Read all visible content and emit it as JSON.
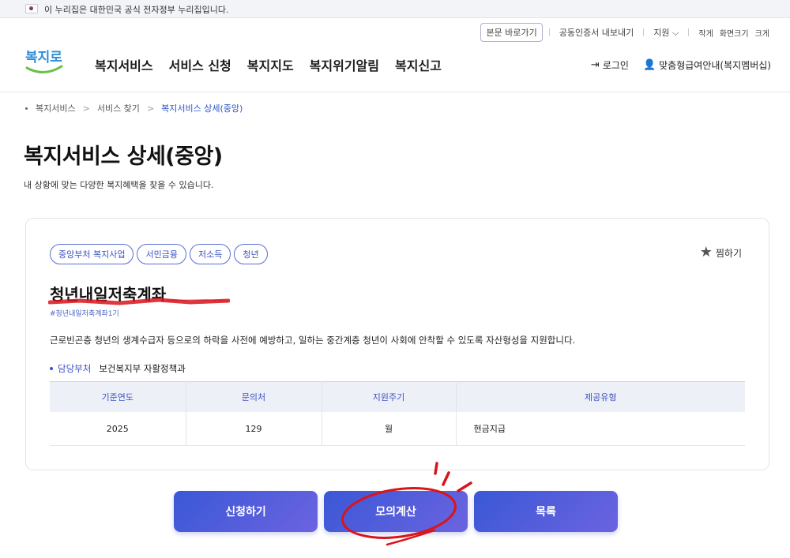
{
  "gov_banner": {
    "text": "이 누리집은 대한민국 공식 전자정부 누리집입니다."
  },
  "utility": {
    "skip_to_content": "본문 바로가기",
    "cert_export": "공동인증서 내보내기",
    "language": "지원",
    "text_small": "작게",
    "text_size": "화면크기",
    "text_large": "크게"
  },
  "logo": {
    "text": "복지로"
  },
  "nav": {
    "items": [
      "복지서비스",
      "서비스 신청",
      "복지지도",
      "복지위기알림",
      "복지신고"
    ]
  },
  "header_right": {
    "login": "로그인",
    "custom_info": "맞춤형급여안내(복지멤버십)"
  },
  "breadcrumb": [
    "복지서비스",
    "서비스 찾기",
    "복지서비스 상세(중앙)"
  ],
  "page": {
    "title": "복지서비스 상세(중앙)",
    "subtitle": "내 상황에 맞는 다양한 복지혜택을 찾을 수 있습니다."
  },
  "service": {
    "tags": [
      "중앙부처 복지사업",
      "서민금융",
      "저소득",
      "청년"
    ],
    "favorite": "찜하기",
    "name": "청년내일저축계좌",
    "hashtag": "#청년내일저축계좌1기",
    "description": "근로빈곤층 청년의 생계수급자 등으로의 하락을 사전에 예방하고, 일하는 중간계층 청년이 사회에 안착할 수 있도록 자산형성을 지원합니다.",
    "dept_label": "담당부처",
    "dept_value": "보건복지부 자활정책과"
  },
  "info_table": {
    "headers": [
      "기준연도",
      "문의처",
      "지원주기",
      "제공유형"
    ],
    "row": [
      "2025",
      "129",
      "월",
      "현금지급"
    ]
  },
  "buttons": {
    "apply": "신청하기",
    "simulate": "모의계산",
    "list": "목록"
  },
  "colors": {
    "accent": "#3b52c4",
    "button": "#4a5ddb",
    "annotation": "#d9141b"
  }
}
